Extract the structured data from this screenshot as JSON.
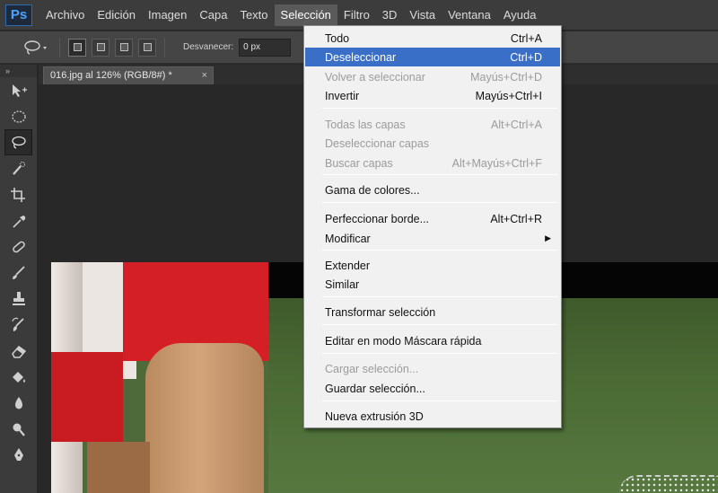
{
  "app": {
    "logo": "Ps"
  },
  "menubar": {
    "items": [
      "Archivo",
      "Edición",
      "Imagen",
      "Capa",
      "Texto",
      "Selección",
      "Filtro",
      "3D",
      "Vista",
      "Ventana",
      "Ayuda"
    ],
    "active": "Selección"
  },
  "options": {
    "feather_label": "Desvanecer:",
    "feather_value": "0 px"
  },
  "tools_panel": {
    "collapse_glyph": "»"
  },
  "document": {
    "tab_title": "016.jpg al 126% (RGB/8#) *",
    "close_glyph": "×"
  },
  "selection_menu": {
    "items": [
      {
        "label": "Todo",
        "shortcut": "Ctrl+A",
        "enabled": true
      },
      {
        "label": "Deseleccionar",
        "shortcut": "Ctrl+D",
        "enabled": true,
        "highlighted": true
      },
      {
        "label": "Volver a seleccionar",
        "shortcut": "Mayús+Ctrl+D",
        "enabled": false
      },
      {
        "label": "Invertir",
        "shortcut": "Mayús+Ctrl+I",
        "enabled": true
      },
      {
        "label": "Todas las capas",
        "shortcut": "Alt+Ctrl+A",
        "enabled": false
      },
      {
        "label": "Deseleccionar capas",
        "shortcut": "",
        "enabled": false
      },
      {
        "label": "Buscar capas",
        "shortcut": "Alt+Mayús+Ctrl+F",
        "enabled": false
      },
      {
        "label": "Gama de colores...",
        "shortcut": "",
        "enabled": true
      },
      {
        "label": "Perfeccionar borde...",
        "shortcut": "Alt+Ctrl+R",
        "enabled": true
      },
      {
        "label": "Modificar",
        "shortcut": "",
        "enabled": true,
        "submenu": true
      },
      {
        "label": "Extender",
        "shortcut": "",
        "enabled": true
      },
      {
        "label": "Similar",
        "shortcut": "",
        "enabled": true
      },
      {
        "label": "Transformar selección",
        "shortcut": "",
        "enabled": true
      },
      {
        "label": "Editar en modo Máscara rápida",
        "shortcut": "",
        "enabled": true
      },
      {
        "label": "Cargar selección...",
        "shortcut": "",
        "enabled": false
      },
      {
        "label": "Guardar selección...",
        "shortcut": "",
        "enabled": true
      },
      {
        "label": "Nueva extrusión 3D",
        "shortcut": "",
        "enabled": true
      }
    ]
  },
  "colors": {
    "menu_highlight": "#3a6fc8",
    "disabled_text": "#9b9b9b"
  }
}
